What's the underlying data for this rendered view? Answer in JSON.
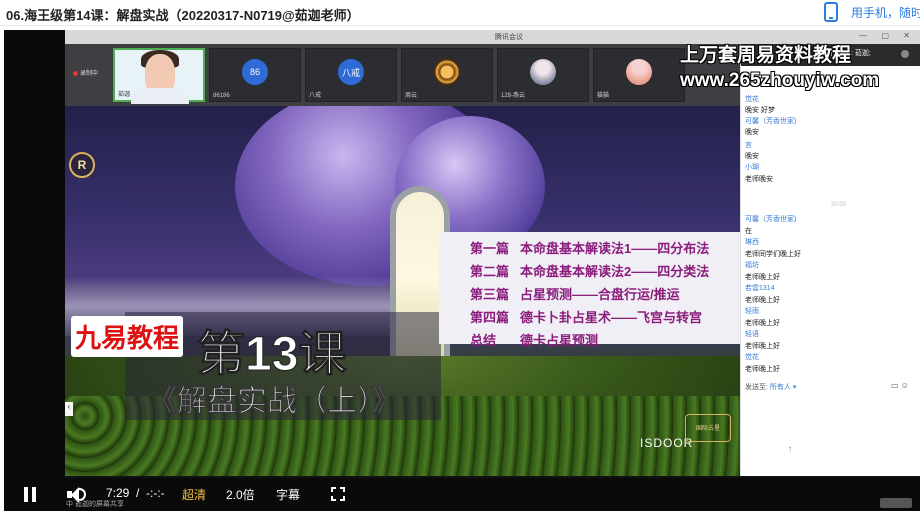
{
  "page": {
    "title": "06.海王级第14课：解盘实战（20220317-N0719@茹迦老师）",
    "phone_link": "用手机，随时"
  },
  "meeting": {
    "window_title": "腾讯会议",
    "recording": "录制中",
    "participants": [
      {
        "name": "茹迦",
        "avatar_text": "",
        "avatar": "camera"
      },
      {
        "name": "86186",
        "avatar_text": "86",
        "avatar": "blue"
      },
      {
        "name": "八戒",
        "avatar_text": "八戒",
        "avatar": "blue"
      },
      {
        "name": "周云",
        "avatar_text": "",
        "avatar": "gold"
      },
      {
        "name": "128-燕云",
        "avatar_text": "",
        "avatar": "photo"
      },
      {
        "name": "猫猫",
        "avatar_text": "",
        "avatar": "pink"
      }
    ],
    "share_bar": "中  茹迦的屏幕共享"
  },
  "slide": {
    "brand_tag": "九易教程",
    "lesson": "第13课",
    "subtitle": "《解盘实战（上）》",
    "logo_letter": "R",
    "toc": [
      {
        "part": "第一篇",
        "text": "本命盘基本解读法1——四分布法"
      },
      {
        "part": "第二篇",
        "text": "本命盘基本解读法2——四分类法"
      },
      {
        "part": "第三篇",
        "text": "占星预测——合盘行运/推运"
      },
      {
        "part": "第四篇",
        "text": "德卡卜卦占星术——飞宫与转宫"
      },
      {
        "part": "总结",
        "text": "德卡占星预测"
      }
    ],
    "footer_brand": "ISDOOR",
    "badge": "国际占星"
  },
  "chat": {
    "header": "正在讲话: 茹迦;",
    "messages": [
      {
        "kind": "name",
        "text": "觉花"
      },
      {
        "kind": "text",
        "text": "晚安 好梦"
      },
      {
        "kind": "name",
        "text": "可馨（芳香世家)"
      },
      {
        "kind": "text",
        "text": "晚安"
      },
      {
        "kind": "name",
        "text": "言"
      },
      {
        "kind": "text",
        "text": "晚安"
      },
      {
        "kind": "name",
        "text": "小瑚"
      },
      {
        "kind": "text",
        "text": "老师晚安"
      },
      {
        "kind": "name",
        "text": "可馨（芳香世家)"
      },
      {
        "kind": "text",
        "text": "在"
      },
      {
        "kind": "name",
        "text": "琳西"
      },
      {
        "kind": "text",
        "text": "老师同学们晚上好"
      },
      {
        "kind": "name",
        "text": "福坊"
      },
      {
        "kind": "text",
        "text": "老师晚上好"
      },
      {
        "kind": "name",
        "text": "若雲1314"
      },
      {
        "kind": "text",
        "text": "老师晚上好"
      },
      {
        "kind": "name",
        "text": "轻雨"
      },
      {
        "kind": "text",
        "text": "老师晚上好"
      },
      {
        "kind": "name",
        "text": "轻语"
      },
      {
        "kind": "text",
        "text": "老师晚上好"
      },
      {
        "kind": "name",
        "text": "觉花"
      },
      {
        "kind": "text",
        "text": "老师晚上好"
      }
    ],
    "time_divider": "20:00",
    "input_label": "发送至:",
    "input_target": "所有人 ▾",
    "send_icon": "↑"
  },
  "watermark": {
    "line1": "上万套周易资料教程",
    "line2": "www.265zhouyiw.com"
  },
  "controls": {
    "time": "7:29",
    "separator": "/",
    "duration": "-:-:-",
    "quality": "超清",
    "speed": "2.0倍",
    "subtitle": "字幕"
  },
  "colors": {
    "accent": "#2a7de1",
    "toc_text": "#8a1c7c",
    "brand_red": "#d11111",
    "active_speaker": "#4caf50"
  }
}
